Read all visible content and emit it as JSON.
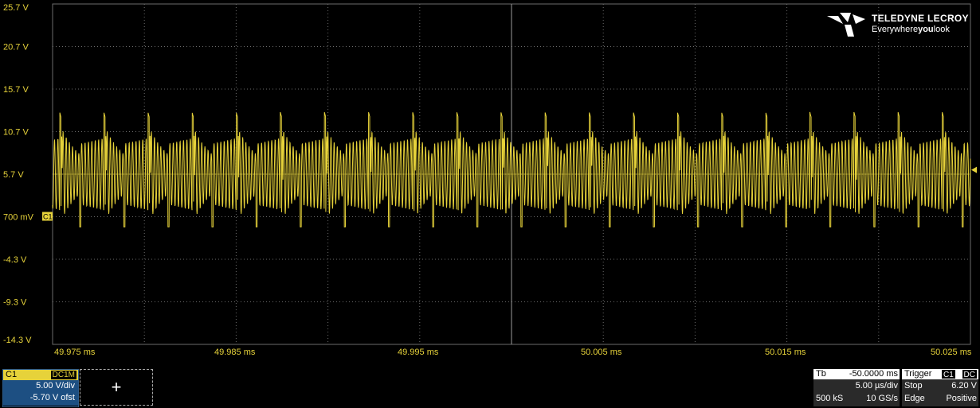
{
  "brand": {
    "name": "TELEDYNE LECROY",
    "tagline_pre": "Everywhere",
    "tagline_bold": "you",
    "tagline_post": "look"
  },
  "colors": {
    "trace": "#e6d23a",
    "grid": "#6b6b6b",
    "background": "#000000",
    "channel_accent": "#1d4f82"
  },
  "y_axis_labels": [
    "25.7 V",
    "20.7 V",
    "15.7 V",
    "10.7 V",
    "5.7 V",
    "700 mV",
    "-4.3 V",
    "-9.3 V",
    "-14.3 V"
  ],
  "x_axis_labels": [
    "49.975 ms",
    "49.985 ms",
    "49.995 ms",
    "50.005 ms",
    "50.015 ms",
    "50.025 ms"
  ],
  "marker_label": "C1",
  "channel": {
    "name": "C1",
    "coupling": "DC1M",
    "vdiv": "5.00 V/div",
    "offset": "-5.70 V ofst"
  },
  "add_channel": "+",
  "timebase": {
    "label": "Tb",
    "delay": "-50.0000 ms",
    "tdiv": "5.00 µs/div",
    "samples": "500 kS",
    "rate": "10 GS/s"
  },
  "trigger": {
    "label": "Trigger",
    "src": "C1",
    "coupling": "DC",
    "mode": "Stop",
    "level": "6.20 V",
    "type": "Edge",
    "slope": "Positive"
  },
  "chart_data": {
    "type": "line",
    "x_unit": "ms",
    "y_unit": "V",
    "xlim": [
      49.975,
      50.027
    ],
    "ylim": [
      -14.3,
      25.7
    ],
    "grid": true,
    "trigger_level": 6.2,
    "period_us": 2.5,
    "waveform_description_values": {
      "peak_high": 13.0,
      "peak_low": -0.8,
      "midline": 5.7
    }
  }
}
